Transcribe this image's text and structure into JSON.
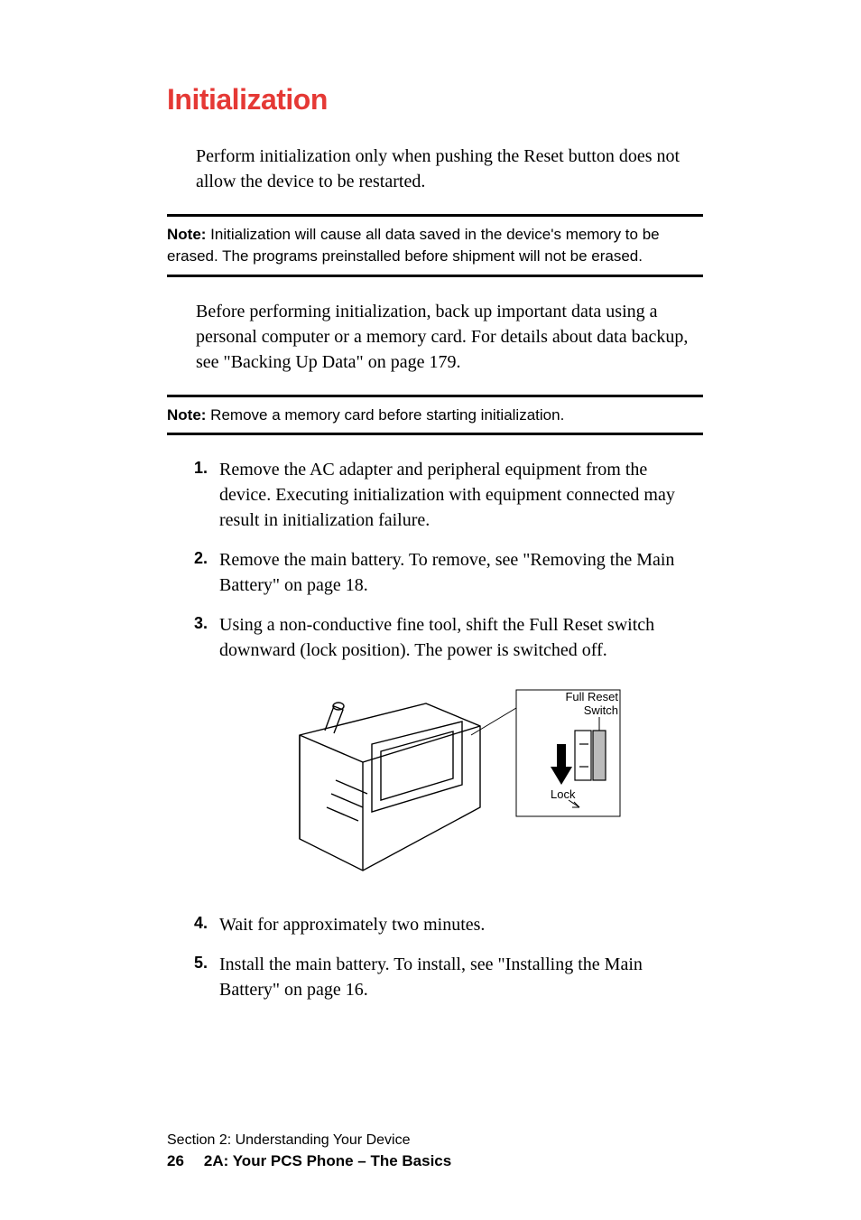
{
  "title": "Initialization",
  "intro": "Perform initialization only when pushing the Reset button does not allow the device to be restarted.",
  "note1": {
    "label": "Note:",
    "text": " Initialization will cause all data saved in the device's memory to be erased. The programs preinstalled before shipment will not be erased."
  },
  "para2": "Before performing initialization, back up important data using a personal computer or a memory card. For details about data backup, see \"Backing Up Data\" on page 179.",
  "note2": {
    "label": "Note:",
    "text": " Remove a memory card before starting initialization."
  },
  "steps": {
    "s1": {
      "num": "1.",
      "text": "Remove the AC adapter and peripheral equipment from the device. Executing initialization with equipment connected may result in initialization failure."
    },
    "s2": {
      "num": "2.",
      "text": "Remove the main battery. To remove, see \"Removing the Main Battery\" on page 18."
    },
    "s3": {
      "num": "3.",
      "text": "Using a non-conductive fine tool, shift the Full Reset switch downward (lock position). The power is switched off."
    },
    "s4": {
      "num": "4.",
      "text": "Wait for approximately two minutes."
    },
    "s5": {
      "num": "5.",
      "text": "Install the main battery. To install, see \"Installing the Main Battery\" on page 16."
    }
  },
  "figure": {
    "callout1": "Full Reset",
    "callout2": "Switch",
    "label_lock": "Lock"
  },
  "footer": {
    "section": "Section 2: Understanding Your Device",
    "page_num": "26",
    "chapter": "2A: Your PCS Phone – The Basics"
  }
}
